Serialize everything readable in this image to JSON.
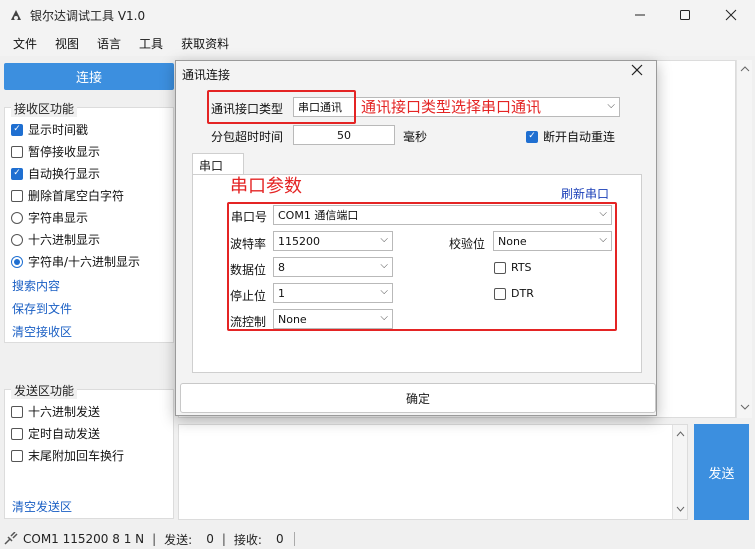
{
  "window": {
    "title": "银尔达调试工具 V1.0"
  },
  "menu": [
    "文件",
    "视图",
    "语言",
    "工具",
    "获取资料"
  ],
  "left": {
    "connect_label": "连接",
    "recv_group": {
      "title": "接收区功能",
      "options": [
        {
          "label": "显示时间戳",
          "kind": "checkbox",
          "checked": true
        },
        {
          "label": "暂停接收显示",
          "kind": "checkbox",
          "checked": false
        },
        {
          "label": "自动换行显示",
          "kind": "checkbox",
          "checked": true
        },
        {
          "label": "删除首尾空白字符",
          "kind": "checkbox",
          "checked": false
        },
        {
          "label": "字符串显示",
          "kind": "radio",
          "checked": false
        },
        {
          "label": "十六进制显示",
          "kind": "radio",
          "checked": false
        },
        {
          "label": "字符串/十六进制显示",
          "kind": "radio",
          "checked": true
        }
      ],
      "links": [
        "搜索内容",
        "保存到文件",
        "清空接收区"
      ]
    },
    "send_group": {
      "title": "发送区功能",
      "options": [
        {
          "label": "十六进制发送",
          "checked": false
        },
        {
          "label": "定时自动发送",
          "checked": false
        },
        {
          "label": "末尾附加回车换行",
          "checked": false
        }
      ],
      "link": "清空发送区"
    }
  },
  "send_label": "发送",
  "status": {
    "port_info": "COM1 115200 8 1 N",
    "sent_label": "发送:",
    "sent_value": "0",
    "recv_label": "接收:",
    "recv_value": "0"
  },
  "dialog": {
    "title": "通讯连接",
    "iface_label": "通讯接口类型",
    "iface_value": "串口通讯",
    "iface_annotation": "通讯接口类型选择串口通讯",
    "timeout_label": "分包超时时间",
    "timeout_value": "50",
    "timeout_unit": "毫秒",
    "auto_reconnect_label": "断开自动重连",
    "auto_reconnect_checked": true,
    "tab_label": "串口",
    "serial_annotation": "串口参数",
    "refresh_label": "刷新串口",
    "port_label": "串口号",
    "port_value": "COM1 通信端口",
    "baud_label": "波特率",
    "baud_value": "115200",
    "parity_label": "校验位",
    "parity_value": "None",
    "databits_label": "数据位",
    "databits_value": "8",
    "rts_label": "RTS",
    "stopbits_label": "停止位",
    "stopbits_value": "1",
    "dtr_label": "DTR",
    "flow_label": "流控制",
    "flow_value": "None",
    "ok_label": "确定"
  },
  "colors": {
    "accent": "#3c8fdf",
    "annotation": "#e42424",
    "link": "#1a5fc4"
  }
}
